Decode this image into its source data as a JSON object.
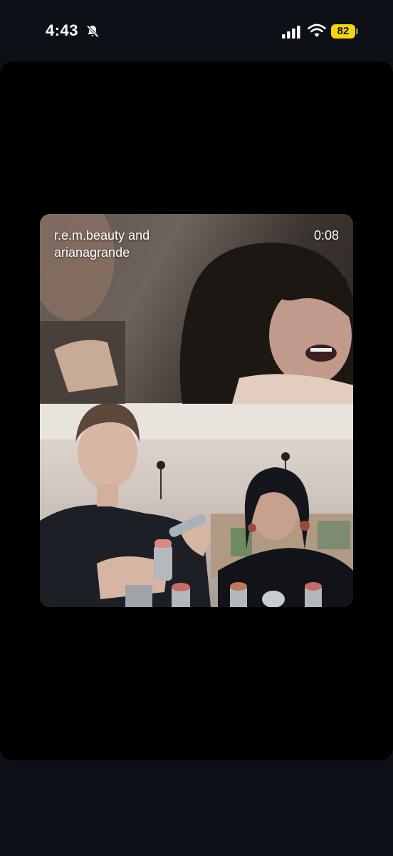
{
  "status_bar": {
    "time": "4:43",
    "battery_level": "82",
    "icons": [
      "bell-slash-icon",
      "cellular-signal-icon",
      "wifi-icon",
      "battery-icon"
    ],
    "battery_color": "#f5d50a"
  },
  "video": {
    "title": "r.e.m.beauty and arianagrande",
    "duration": "0:08"
  },
  "colors": {
    "background": "#0d1117",
    "panel": "#000000"
  }
}
